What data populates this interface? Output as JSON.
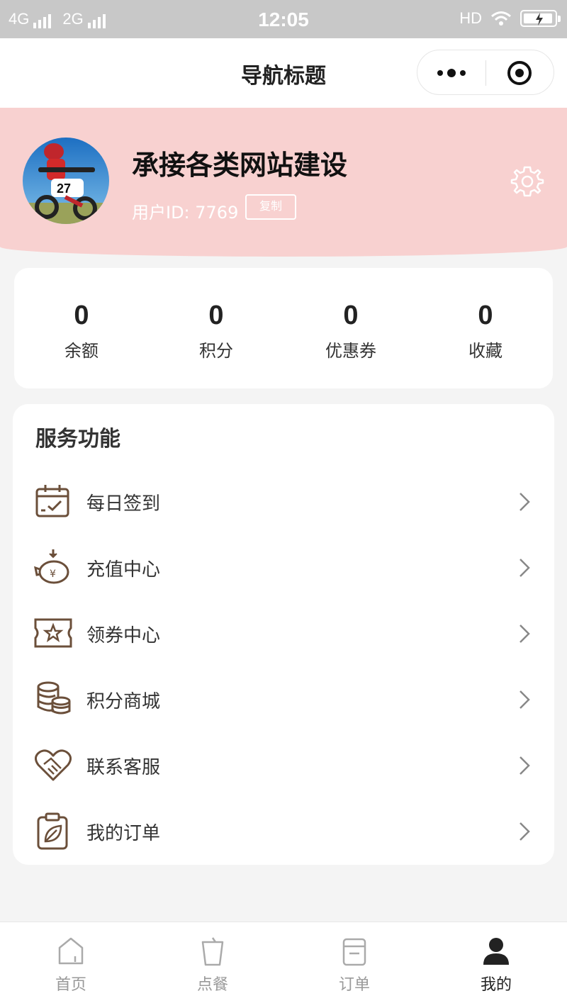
{
  "status_bar": {
    "network_left": "4G",
    "network_right": "2G",
    "time": "12:05",
    "hd": "HD"
  },
  "nav": {
    "title": "导航标题"
  },
  "profile": {
    "name": "承接各类网站建设",
    "user_id": "用户ID: 7769",
    "copy_label": "复制"
  },
  "stats": [
    {
      "value": "0",
      "label": "余额"
    },
    {
      "value": "0",
      "label": "积分"
    },
    {
      "value": "0",
      "label": "优惠券"
    },
    {
      "value": "0",
      "label": "收藏"
    }
  ],
  "services": {
    "title": "服务功能",
    "items": [
      {
        "label": "每日签到",
        "icon": "calendar-check-icon"
      },
      {
        "label": "充值中心",
        "icon": "piggy-bank-icon"
      },
      {
        "label": "领券中心",
        "icon": "coupon-star-icon"
      },
      {
        "label": "积分商城",
        "icon": "coins-stack-icon"
      },
      {
        "label": "联系客服",
        "icon": "heart-handshake-icon"
      },
      {
        "label": "我的订单",
        "icon": "clipboard-leaf-icon"
      }
    ]
  },
  "tabbar": {
    "items": [
      {
        "label": "首页",
        "icon": "home-icon"
      },
      {
        "label": "点餐",
        "icon": "cup-icon"
      },
      {
        "label": "订单",
        "icon": "order-icon"
      },
      {
        "label": "我的",
        "icon": "user-icon"
      }
    ],
    "active_index": 3
  },
  "colors": {
    "header_bg": "#f8d1d0",
    "icon_brown": "#6b4f3a",
    "tab_active": "#222222",
    "tab_inactive": "#999999"
  }
}
